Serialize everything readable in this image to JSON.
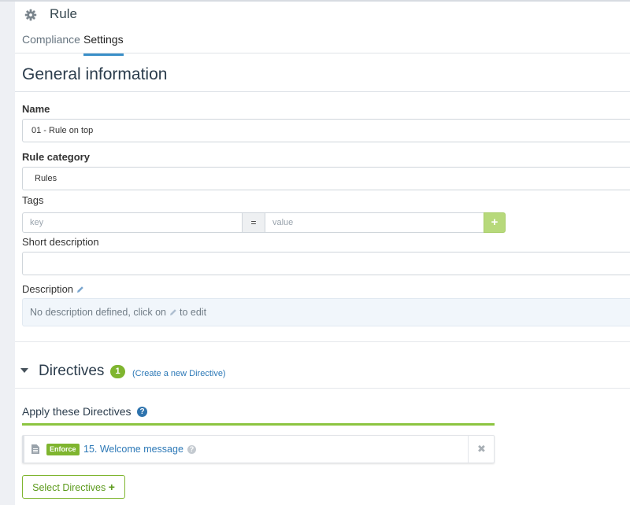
{
  "header": {
    "title": "Rule",
    "tabs": [
      {
        "label": "Compliance",
        "active": false
      },
      {
        "label": "Settings",
        "active": true
      }
    ]
  },
  "general": {
    "section_title": "General information",
    "name_label": "Name",
    "name_value": "01 - Rule on top",
    "category_label": "Rule category",
    "category_value": "Rules",
    "tags_label": "Tags",
    "tag_key_placeholder": "key",
    "tag_equals": "=",
    "tag_value_placeholder": "value",
    "tag_add_label": "+",
    "short_desc_label": "Short description",
    "short_desc_value": "",
    "description_label": "Description",
    "description_text_before": "No description defined, click on",
    "description_text_after": "to edit"
  },
  "directives": {
    "section_title": "Directives",
    "count": "1",
    "create_link": "(Create a new Directive)",
    "apply_label": "Apply these Directives",
    "help_glyph": "?",
    "items": [
      {
        "badge": "Enforce",
        "name": "15. Welcome message",
        "help_glyph": "?",
        "remove_glyph": "✖"
      }
    ],
    "select_button_label": "Select Directives",
    "select_button_plus": "+"
  },
  "colors": {
    "accent_green": "#7fb52f",
    "link_blue": "#2d79b7",
    "tab_active_underline": "#3a8fc8"
  },
  "icons": [
    "gear-icon",
    "pencil-icon",
    "caret-down-icon",
    "help-icon",
    "document-icon",
    "close-icon",
    "plus-icon"
  ]
}
